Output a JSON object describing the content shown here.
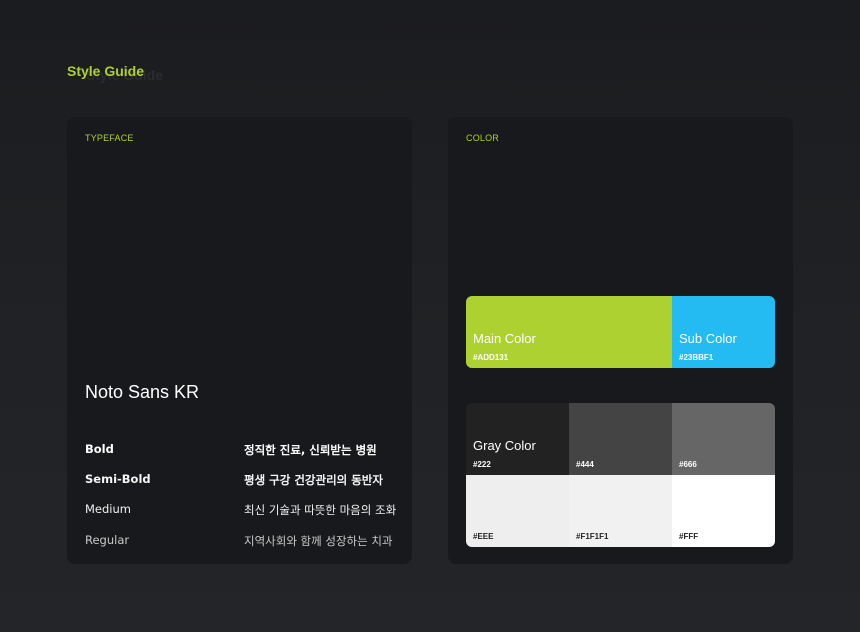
{
  "page": {
    "title": "Style Guide",
    "title_shadow": "Style Guide"
  },
  "typeface": {
    "label": "TYPEFACE",
    "font_name": "Noto Sans KR",
    "weights": [
      {
        "name": "Bold",
        "sample": "정직한 진료, 신뢰받는 병원"
      },
      {
        "name": "Semi-Bold",
        "sample": "평생 구강 건강관리의 동반자"
      },
      {
        "name": "Medium",
        "sample": "최신 기술과 따뜻한 마음의 조화"
      },
      {
        "name": "Regular",
        "sample": "지역사회와 함께 성장하는 치과"
      }
    ]
  },
  "color": {
    "label": "COLOR",
    "main": {
      "title": "Main Color",
      "hex": "#ADD131",
      "value": "#add131"
    },
    "sub": {
      "title": "Sub Color",
      "hex": "#23BBF1",
      "value": "#23bbf1"
    },
    "gray": {
      "title": "Gray Color",
      "swatches": [
        {
          "hex": "#222",
          "value": "#222222"
        },
        {
          "hex": "#444",
          "value": "#444444"
        },
        {
          "hex": "#666",
          "value": "#666666"
        },
        {
          "hex": "#EEE",
          "value": "#eeeeee"
        },
        {
          "hex": "#F1F1F1",
          "value": "#f1f1f1"
        },
        {
          "hex": "#FFF",
          "value": "#ffffff"
        }
      ]
    }
  },
  "theme": {
    "accent": "#add131",
    "card_background": "#18191c",
    "page_background": "#1f2023"
  }
}
